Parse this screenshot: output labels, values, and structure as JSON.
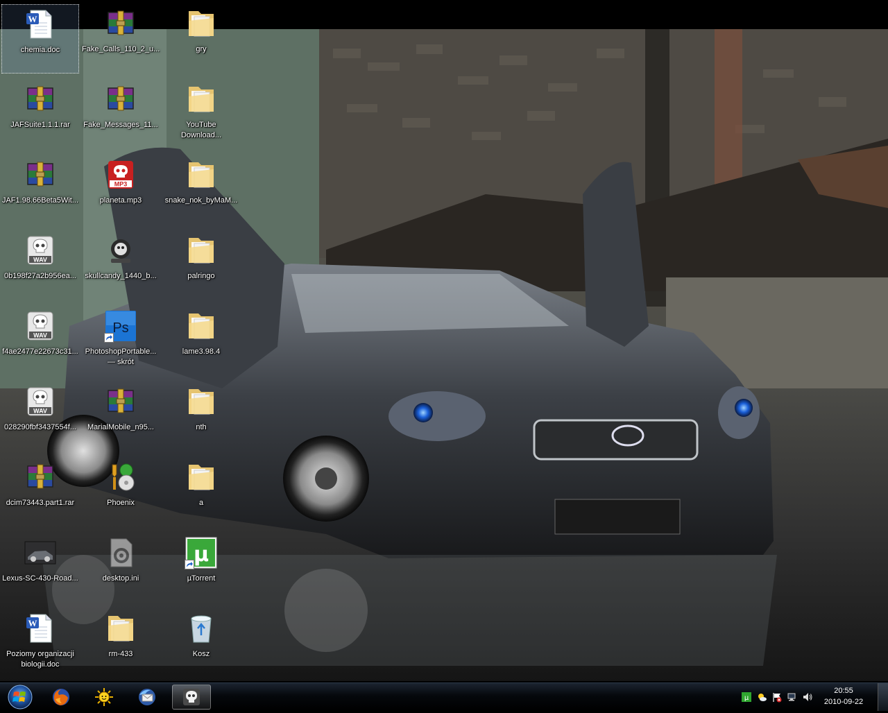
{
  "desktop": {
    "wallpaper": "Lexus sports car with scissor doors in front of a ruined brick building",
    "icons": [
      {
        "label": "chemia.doc",
        "icon": "word-document-icon"
      },
      {
        "label": "Fake_Calls_110_2_u...",
        "icon": "winrar-archive-icon"
      },
      {
        "label": "gry",
        "icon": "folder-icon"
      },
      {
        "label": "JAFSuite1.1.1.rar",
        "icon": "winrar-archive-icon"
      },
      {
        "label": "Fake_Messages_11...",
        "icon": "winrar-archive-icon"
      },
      {
        "label": "YouTube\nDownload...",
        "icon": "folder-icon"
      },
      {
        "label": "JAF1.98.66Beta5Wit...",
        "icon": "winrar-archive-icon"
      },
      {
        "label": "planeta.mp3",
        "icon": "mp3-file-icon"
      },
      {
        "label": "snake_nok_byMaM...",
        "icon": "folder-icon"
      },
      {
        "label": "0b198f27a2b956ea...",
        "icon": "wav-file-icon"
      },
      {
        "label": "skullcandy_1440_b...",
        "icon": "image-file-icon"
      },
      {
        "label": "palringo",
        "icon": "folder-icon"
      },
      {
        "label": "f4ae2477e22673c31...",
        "icon": "wav-file-icon"
      },
      {
        "label": "PhotoshopPortable...\n— skrót",
        "icon": "photoshop-icon"
      },
      {
        "label": "lame3.98.4",
        "icon": "folder-icon"
      },
      {
        "label": "028290fbf3437554f...",
        "icon": "wav-file-icon"
      },
      {
        "label": "MarialMobile_n95...",
        "icon": "winrar-archive-icon"
      },
      {
        "label": "nth",
        "icon": "folder-icon"
      },
      {
        "label": "dcim73443.part1.rar",
        "icon": "winrar-archive-icon"
      },
      {
        "label": "Phoenix",
        "icon": "phoenix-tool-icon"
      },
      {
        "label": "a",
        "icon": "folder-icon"
      },
      {
        "label": "Lexus-SC-430-Road...",
        "icon": "image-thumbnail-icon"
      },
      {
        "label": "desktop.ini",
        "icon": "settings-file-icon"
      },
      {
        "label": "µTorrent",
        "icon": "utorrent-icon"
      },
      {
        "label": "Poziomy organizacji\nbiologii.doc",
        "icon": "word-document-icon"
      },
      {
        "label": "rm-433",
        "icon": "folder-icon"
      },
      {
        "label": "Kosz",
        "icon": "recycle-bin-icon"
      }
    ]
  },
  "taskbar": {
    "pinned": [
      {
        "name": "firefox",
        "icon": "firefox-icon"
      },
      {
        "name": "sun-app",
        "icon": "sun-icon"
      },
      {
        "name": "thunderbird",
        "icon": "thunderbird-icon"
      },
      {
        "name": "wav-player",
        "icon": "skull-media-icon"
      }
    ],
    "tray": {
      "time": "20:55",
      "date": "2010-09-22",
      "icons": [
        "utorrent-tray-icon",
        "weather-tray-icon",
        "flag-tray-icon",
        "network-tray-icon",
        "volume-tray-icon"
      ]
    }
  },
  "colors": {
    "accent": "#1e66c8",
    "taskbar": "#05080c"
  }
}
